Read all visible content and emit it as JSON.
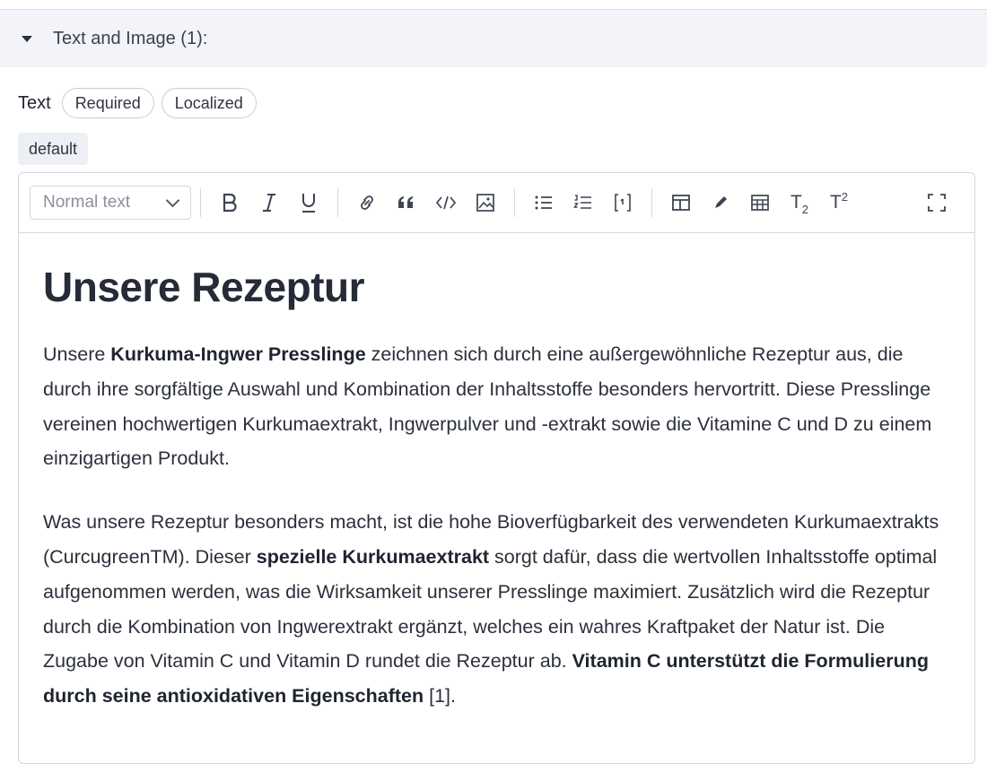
{
  "section": {
    "title": "Text and Image (1):"
  },
  "field": {
    "label": "Text",
    "badges": [
      "Required",
      "Localized"
    ],
    "locale": "default"
  },
  "toolbar": {
    "format_value": "Normal text",
    "subscript_base": "T",
    "subscript_mark": "2",
    "superscript_base": "T",
    "superscript_mark": "2",
    "icons": [
      "bold-icon",
      "italic-icon",
      "underline-icon",
      "link-icon",
      "quote-icon",
      "code-icon",
      "image-icon",
      "bullet-list-icon",
      "numbered-list-icon",
      "code-block-icon",
      "layout-icon",
      "pen-icon",
      "table-icon",
      "subscript-icon",
      "superscript-icon",
      "fullscreen-icon"
    ]
  },
  "doc": {
    "heading": "Unsere Rezeptur",
    "p1": {
      "t1": "Unsere ",
      "b1": "Kurkuma-Ingwer Presslinge",
      "t2": " zeichnen sich durch eine außergewöhnliche Rezeptur aus, die durch ihre sorgfältige Auswahl und Kombination der Inhaltsstoffe besonders hervortritt. Diese Presslinge vereinen hochwertigen Kurkumaextrakt, Ingwerpulver und -extrakt sowie die Vitamine C und D zu einem einzigartigen Produkt."
    },
    "p2": {
      "t1": "Was unsere Rezeptur besonders macht, ist die hohe Bioverfügbarkeit des verwendeten Kurkumaextrakts (CurcugreenTM). Dieser ",
      "b1": "spezielle Kurkumaextrakt",
      "t2": " sorgt dafür, dass die wertvollen Inhaltsstoffe optimal aufgenommen werden, was die Wirksamkeit unserer Presslinge maximiert. Zusätzlich wird die Rezeptur durch die Kombination von Ingwerextrakt ergänzt, welches ein wahres Kraftpaket der Natur ist. Die Zugabe von Vitamin C und Vitamin D rundet die Rezeptur ab. ",
      "b2": "Vitamin C unterstützt die Formulierung durch seine antioxidativen Eigenschaften",
      "t3": " [1]."
    }
  }
}
